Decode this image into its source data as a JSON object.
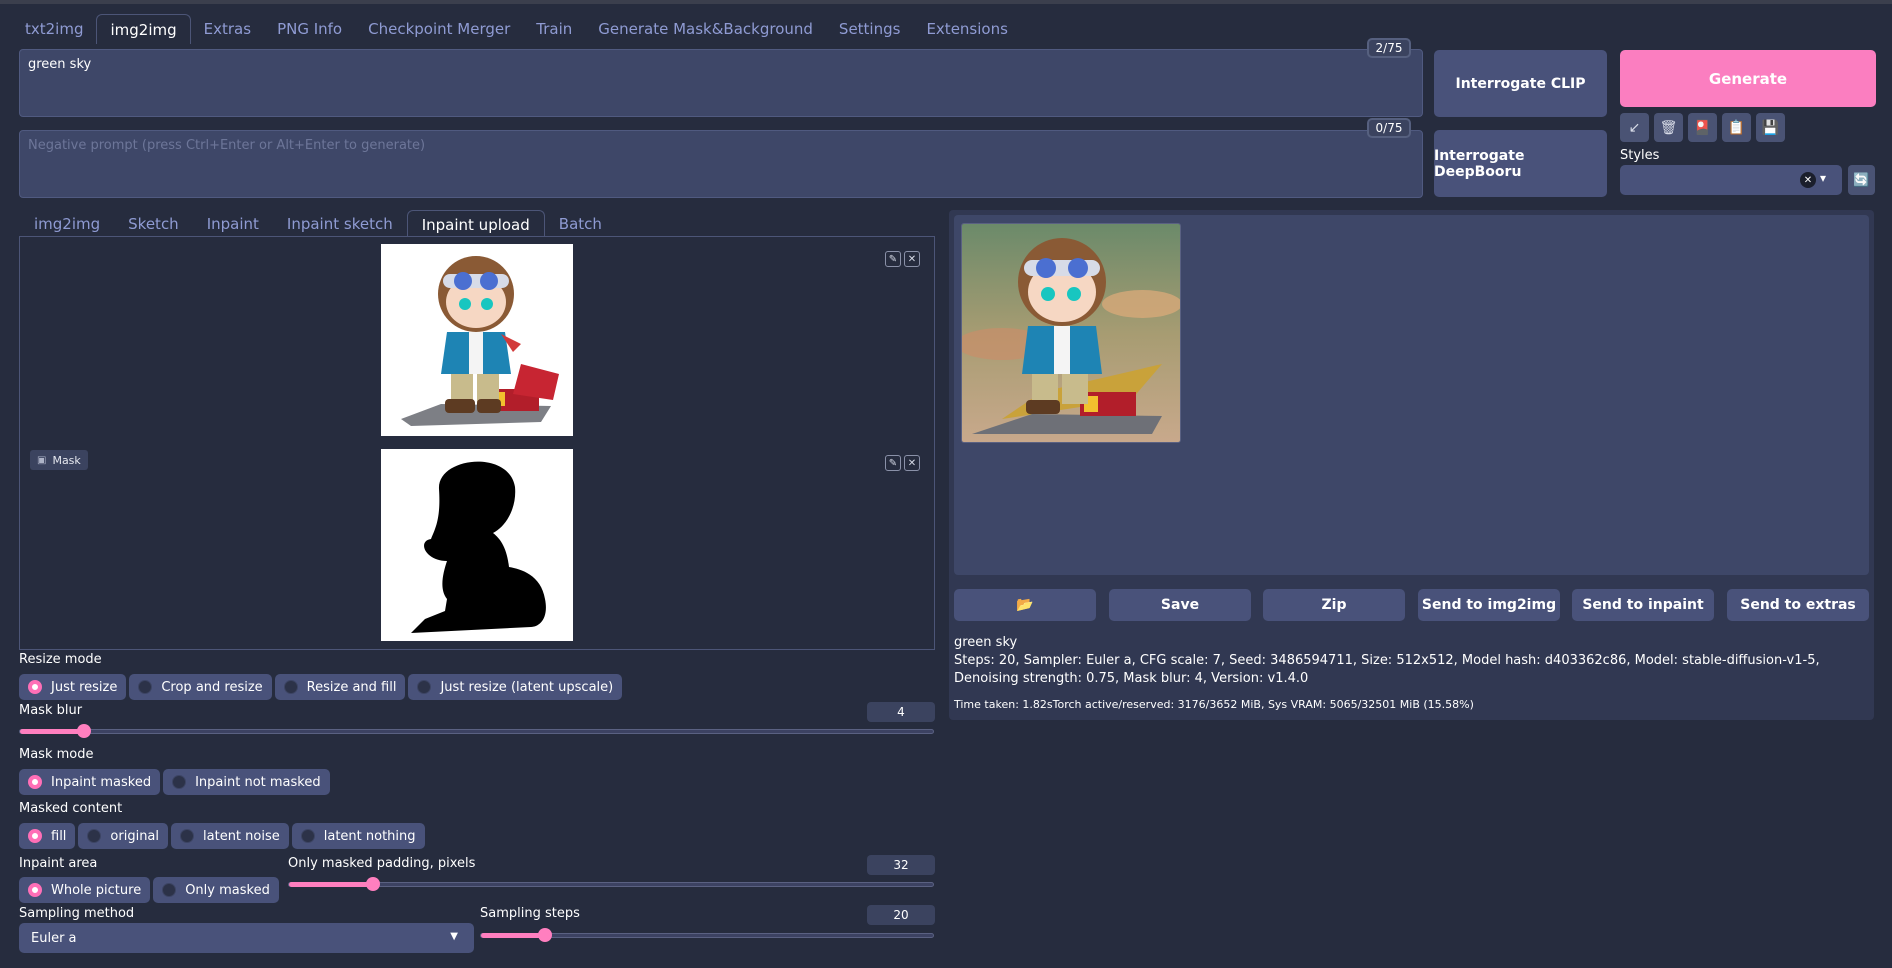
{
  "top_tabs": [
    "txt2img",
    "img2img",
    "Extras",
    "PNG Info",
    "Checkpoint Merger",
    "Train",
    "Generate Mask&Background",
    "Settings",
    "Extensions"
  ],
  "prompt": {
    "value": "green sky",
    "counter": "2/75"
  },
  "negative_prompt": {
    "placeholder": "Negative prompt (press Ctrl+Enter or Alt+Enter to generate)",
    "counter": "0/75"
  },
  "buttons": {
    "interrogate_clip": "Interrogate CLIP",
    "interrogate_deepbooru": "Interrogate DeepBooru",
    "generate": "Generate"
  },
  "tool_icons": {
    "arrow": "↙",
    "trash": "🗑",
    "card": "🎴",
    "paste": "📋",
    "save": "💾"
  },
  "styles": {
    "label": "Styles",
    "clear": "✕",
    "dropdown": "▾",
    "refresh": "🔄"
  },
  "sub_tabs": [
    "img2img",
    "Sketch",
    "Inpaint",
    "Inpaint sketch",
    "Inpaint upload",
    "Batch"
  ],
  "mask_label": "Mask",
  "edit_icon": "✎",
  "close_icon": "✕",
  "resize_mode": {
    "label": "Resize mode",
    "options": [
      "Just resize",
      "Crop and resize",
      "Resize and fill",
      "Just resize (latent upscale)"
    ],
    "selected": 0
  },
  "mask_blur": {
    "label": "Mask blur",
    "value": "4",
    "fraction": 0.07
  },
  "mask_mode": {
    "label": "Mask mode",
    "options": [
      "Inpaint masked",
      "Inpaint not masked"
    ],
    "selected": 0
  },
  "masked_content": {
    "label": "Masked content",
    "options": [
      "fill",
      "original",
      "latent noise",
      "latent nothing"
    ],
    "selected": 0
  },
  "inpaint_area": {
    "label": "Inpaint area",
    "options": [
      "Whole picture",
      "Only masked"
    ],
    "selected": 0
  },
  "only_masked_padding": {
    "label": "Only masked padding, pixels",
    "value": "32",
    "fraction": 0.13
  },
  "sampling_method": {
    "label": "Sampling method",
    "value": "Euler a"
  },
  "sampling_steps": {
    "label": "Sampling steps",
    "value": "20",
    "fraction": 0.14
  },
  "output_buttons": {
    "folder": "📂",
    "save": "Save",
    "zip": "Zip",
    "send_img2img": "Send to img2img",
    "send_inpaint": "Send to inpaint",
    "send_extras": "Send to extras"
  },
  "output_info": {
    "prompt": "green sky",
    "params": "Steps: 20, Sampler: Euler a, CFG scale: 7, Seed: 3486594711, Size: 512x512, Model hash: d403362c86, Model: stable-diffusion-v1-5, Denoising strength: 0.75, Mask blur: 4, Version: v1.4.0",
    "timing": "Time taken: 1.82sTorch active/reserved: 3176/3652 MiB, Sys VRAM: 5065/32501 MiB (15.58%)"
  },
  "colors": {
    "accent": "#ff7fbf",
    "panel": "#3e4768",
    "background": "#262c3e"
  }
}
